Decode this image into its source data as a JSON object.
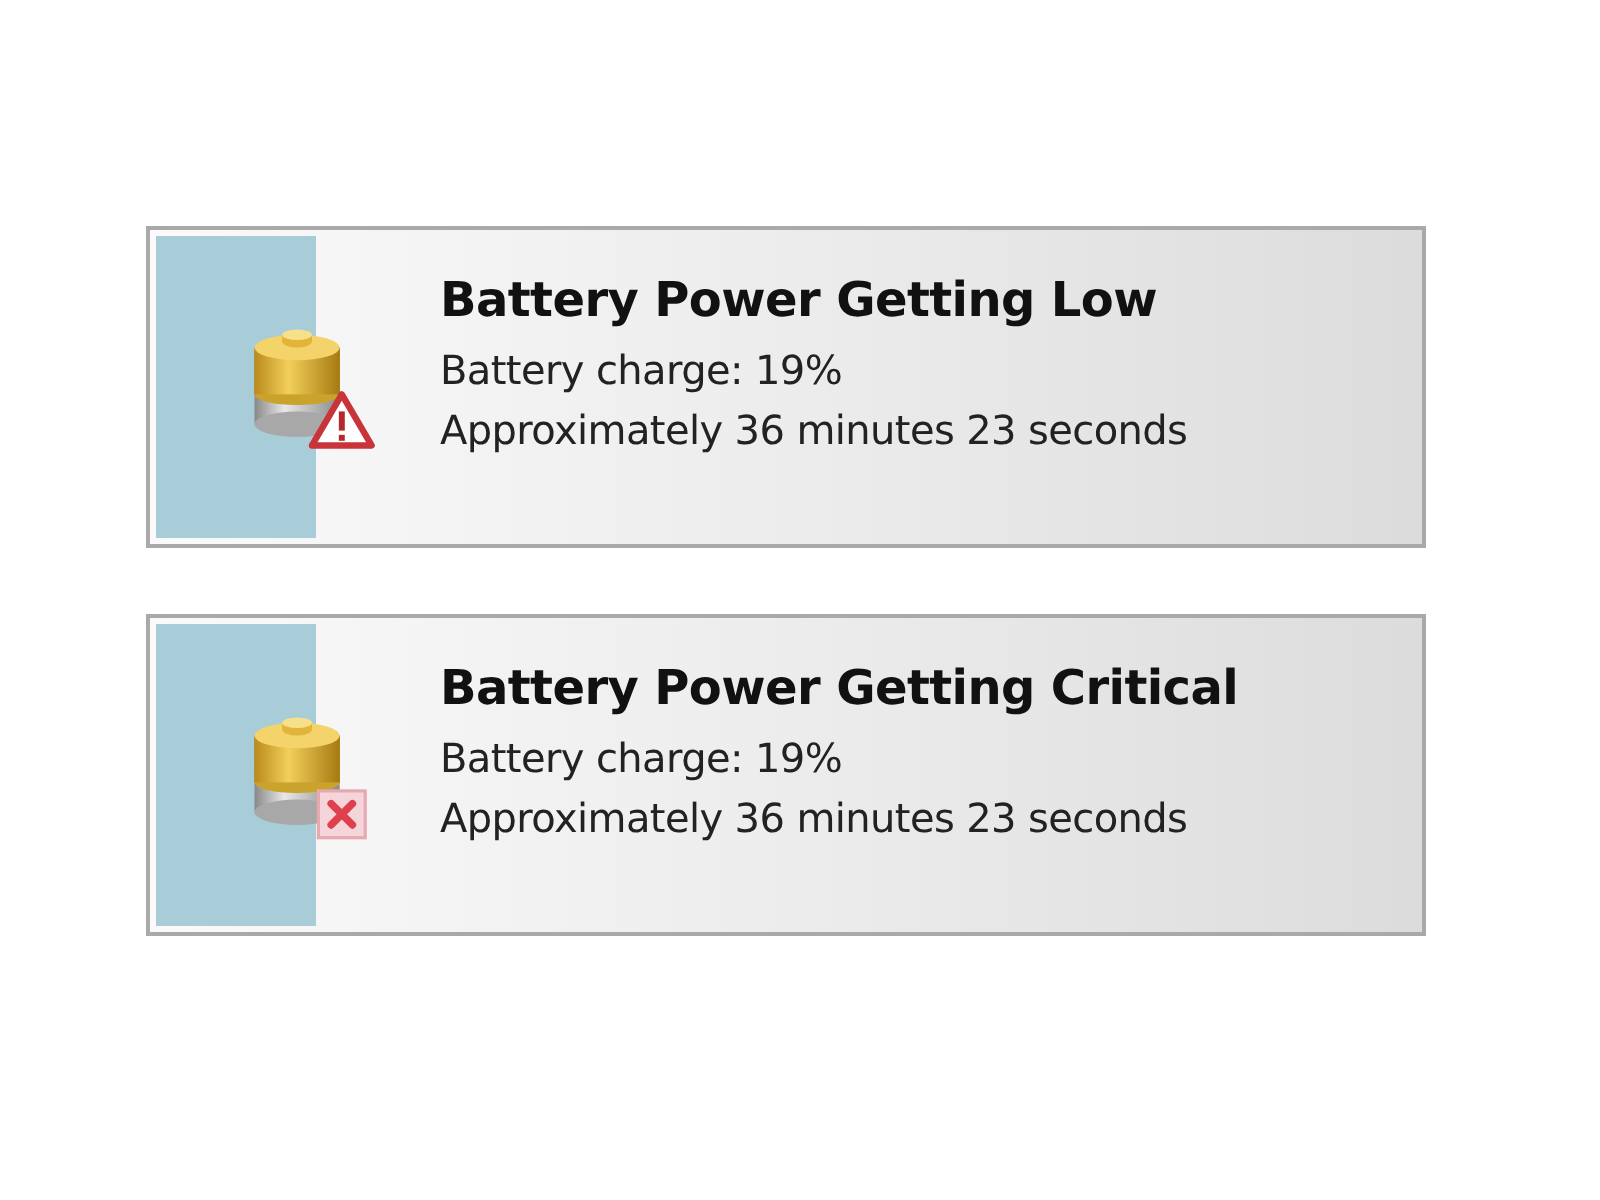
{
  "notifications": [
    {
      "kind": "warning",
      "title": "Battery Power Getting Low",
      "lines": [
        "Battery charge: 19%",
        "Approximately 36 minutes 23 seconds"
      ]
    },
    {
      "kind": "critical",
      "title": "Battery Power Getting Critical",
      "lines": [
        "Battery charge: 19%",
        "Approximately 36 minutes 23 seconds"
      ]
    }
  ]
}
